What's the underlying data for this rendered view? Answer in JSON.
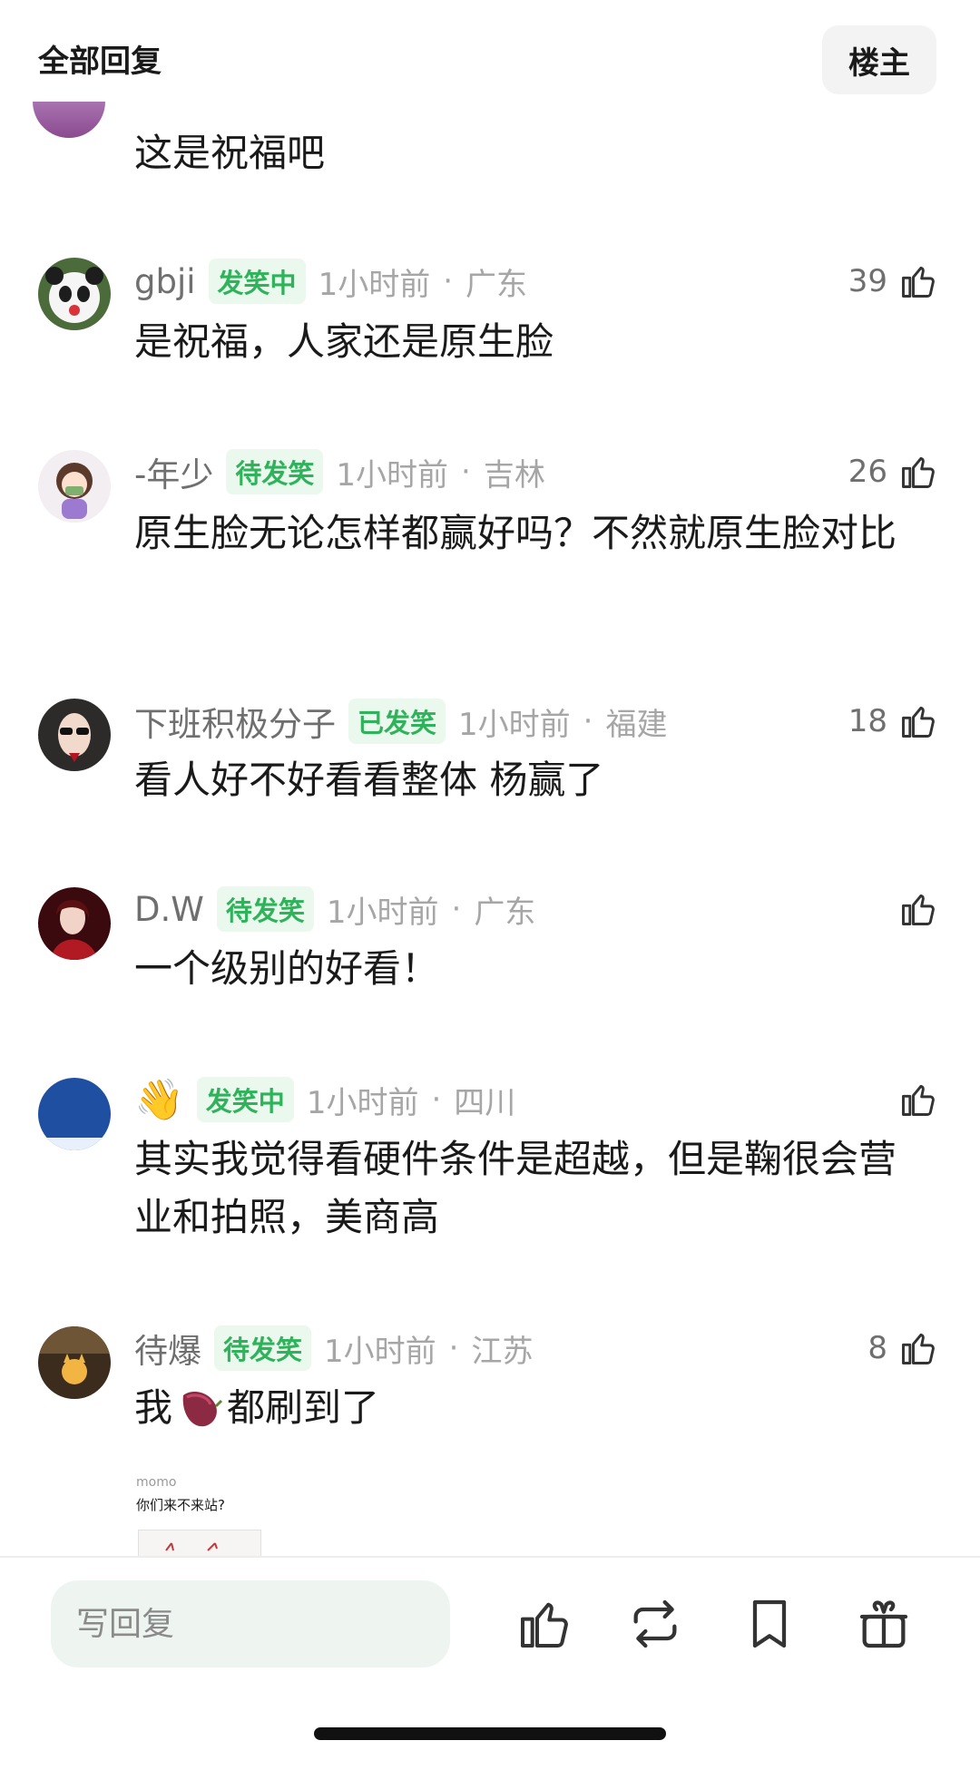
{
  "header": {
    "title": "全部回复",
    "owner_button": "楼主"
  },
  "comments": [
    {
      "text": "这是祝福吧"
    },
    {
      "name": "gbji",
      "badge": "发笑中",
      "time": "1小时前",
      "region": "广东",
      "likes": "39",
      "text": "是祝福，人家还是原生脸"
    },
    {
      "name": "-年少",
      "badge": "待发笑",
      "time": "1小时前",
      "region": "吉林",
      "likes": "26",
      "text": "原生脸无论怎样都赢好吗？不然就原生脸对比"
    },
    {
      "name": "下班积极分子",
      "badge": "已发笑",
      "time": "1小时前",
      "region": "福建",
      "likes": "18",
      "text": "看人好不好看看整体 杨赢了"
    },
    {
      "name": "D.W",
      "badge": "待发笑",
      "time": "1小时前",
      "region": "广东",
      "likes": "",
      "text": "一个级别的好看！"
    },
    {
      "name": "👋",
      "badge": "发笑中",
      "time": "1小时前",
      "region": "四川",
      "likes": "",
      "text": "其实我觉得看硬件条件是超越，但是鞠很会营业和拍照，美商高"
    },
    {
      "name": "待爆",
      "badge": "待发笑",
      "time": "1小时前",
      "region": "江苏",
      "likes": "8",
      "text_before": "我",
      "text_after": "都刷到了"
    }
  ],
  "embedded": {
    "name": "momo",
    "text": "你们来不来站?"
  },
  "footer": {
    "reply_placeholder": "写回复"
  },
  "separator": "·",
  "icons": [
    "thumbs-up-icon",
    "repost-icon",
    "bookmark-icon",
    "gift-icon"
  ],
  "colors": {
    "accent": "#2fb35a",
    "badge_bg": "#eaf8ee"
  }
}
